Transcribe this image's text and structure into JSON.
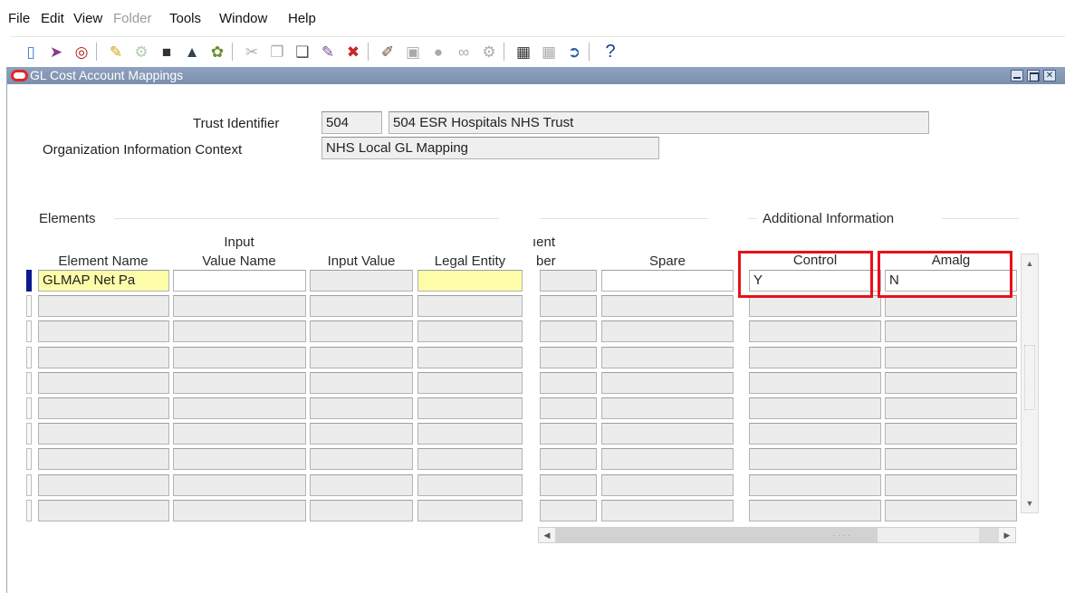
{
  "menu": {
    "file": "File",
    "edit": "Edit",
    "view": "View",
    "folder": "Folder",
    "tools": "Tools",
    "window": "Window",
    "help": "Help"
  },
  "toolbar": {
    "icons": [
      "save-icon",
      "navigator-icon",
      "zoom-icon",
      "open-folder-icon",
      "find-icon",
      "print-icon",
      "print-preview-icon",
      "attachments-icon",
      "cut-icon",
      "copy-icon",
      "paste-icon",
      "edit-field-icon",
      "clear-record-icon",
      "edit-icon",
      "translations-icon",
      "globe-icon",
      "attachment-clip-icon",
      "folder-tools-icon",
      "calendar-icon",
      "calendar-disabled-icon",
      "exit-icon",
      "help-icon"
    ],
    "help_glyph": "?"
  },
  "window": {
    "title": "GL Cost Account Mappings",
    "buttons": [
      "minimize",
      "maximize",
      "close"
    ]
  },
  "header": {
    "trust_identifier_label": "Trust Identifier",
    "trust_identifier_code": "504",
    "trust_identifier_name": "504 ESR Hospitals NHS Trust",
    "org_context_label": "Organization Information Context",
    "org_context_value": "NHS Local GL Mapping"
  },
  "sections": {
    "elements": "Elements",
    "additional_information": "Additional Information"
  },
  "columns": {
    "element_name": "Element Name",
    "input_value_name_1": "Input",
    "input_value_name_2": "Value Name",
    "input_value": "Input Value",
    "legal_entity": "Legal Entity",
    "segment_1": "ıent",
    "segment_2": "ber",
    "spare": "Spare",
    "control": "Control",
    "amalg": "Amalg"
  },
  "rows": [
    {
      "element_name": "GLMAP Net Pa",
      "input_value_name": "",
      "input_value": "",
      "legal_entity": "",
      "segment": "",
      "spare": "",
      "control": "Y",
      "amalg": "N"
    },
    {
      "element_name": "",
      "input_value_name": "",
      "input_value": "",
      "legal_entity": "",
      "segment": "",
      "spare": "",
      "control": "",
      "amalg": ""
    },
    {
      "element_name": "",
      "input_value_name": "",
      "input_value": "",
      "legal_entity": "",
      "segment": "",
      "spare": "",
      "control": "",
      "amalg": ""
    },
    {
      "element_name": "",
      "input_value_name": "",
      "input_value": "",
      "legal_entity": "",
      "segment": "",
      "spare": "",
      "control": "",
      "amalg": ""
    },
    {
      "element_name": "",
      "input_value_name": "",
      "input_value": "",
      "legal_entity": "",
      "segment": "",
      "spare": "",
      "control": "",
      "amalg": ""
    },
    {
      "element_name": "",
      "input_value_name": "",
      "input_value": "",
      "legal_entity": "",
      "segment": "",
      "spare": "",
      "control": "",
      "amalg": ""
    },
    {
      "element_name": "",
      "input_value_name": "",
      "input_value": "",
      "legal_entity": "",
      "segment": "",
      "spare": "",
      "control": "",
      "amalg": ""
    },
    {
      "element_name": "",
      "input_value_name": "",
      "input_value": "",
      "legal_entity": "",
      "segment": "",
      "spare": "",
      "control": "",
      "amalg": ""
    },
    {
      "element_name": "",
      "input_value_name": "",
      "input_value": "",
      "legal_entity": "",
      "segment": "",
      "spare": "",
      "control": "",
      "amalg": ""
    },
    {
      "element_name": "",
      "input_value_name": "",
      "input_value": "",
      "legal_entity": "",
      "segment": "",
      "spare": "",
      "control": "",
      "amalg": ""
    }
  ],
  "colors": {
    "title_bar": "#8fa3c0",
    "highlight_box": "#e8101c",
    "required_field": "#fdfca9",
    "current_record_indicator": "#0b1a8c"
  }
}
